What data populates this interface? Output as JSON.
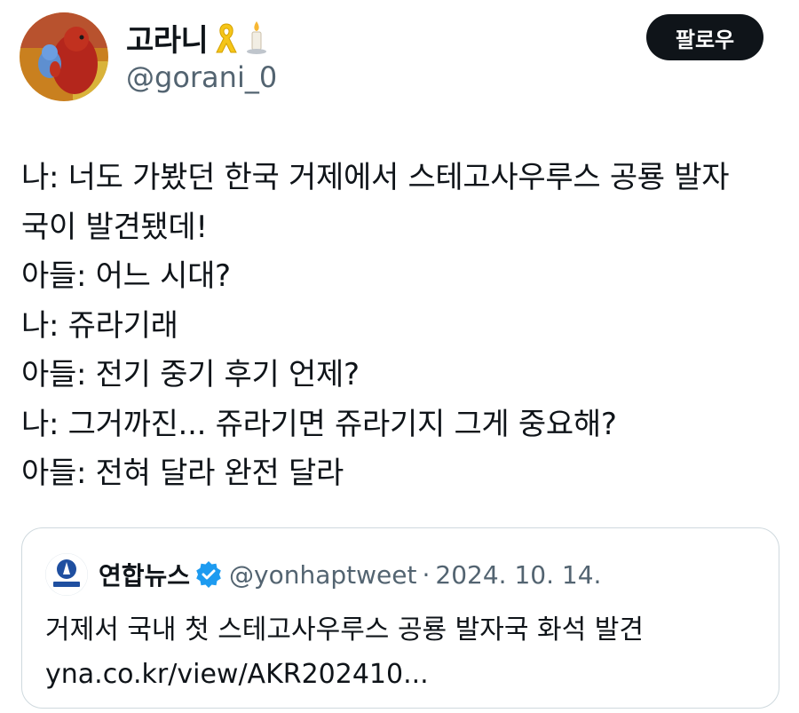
{
  "author": {
    "display_name": "고라니",
    "handle": "@gorani_0",
    "emoji_icons": [
      "yellow-ribbon-icon",
      "candle-icon"
    ]
  },
  "follow_button": {
    "label": "팔로우"
  },
  "tweet": {
    "lines": [
      "나: 너도 가봤던 한국 거제에서 스테고사우루스 공룡 발자",
      "국이 발견됐데!",
      "아들: 어느 시대?",
      "나: 쥬라기래",
      "아들: 전기 중기 후기 언제?",
      "나: 그거까진... 쥬라기면 쥬라기지 그게 중요해?",
      "아들: 전혀 달라 완전 달라"
    ]
  },
  "quote": {
    "author_name": "연합뉴스",
    "verified_icon": "verified-badge-icon",
    "handle": "@yonhaptweet",
    "separator": "·",
    "date": "2024. 10. 14.",
    "text_line1": "거제서 국내 첫 스테고사우루스 공룡 발자국 화석 발견",
    "text_line2": "yna.co.kr/view/AKR202410..."
  },
  "colors": {
    "text": "#0f1419",
    "secondary": "#536471",
    "border": "#cfd9de",
    "verified": "#1d9bf0",
    "button_bg": "#0f1419"
  }
}
